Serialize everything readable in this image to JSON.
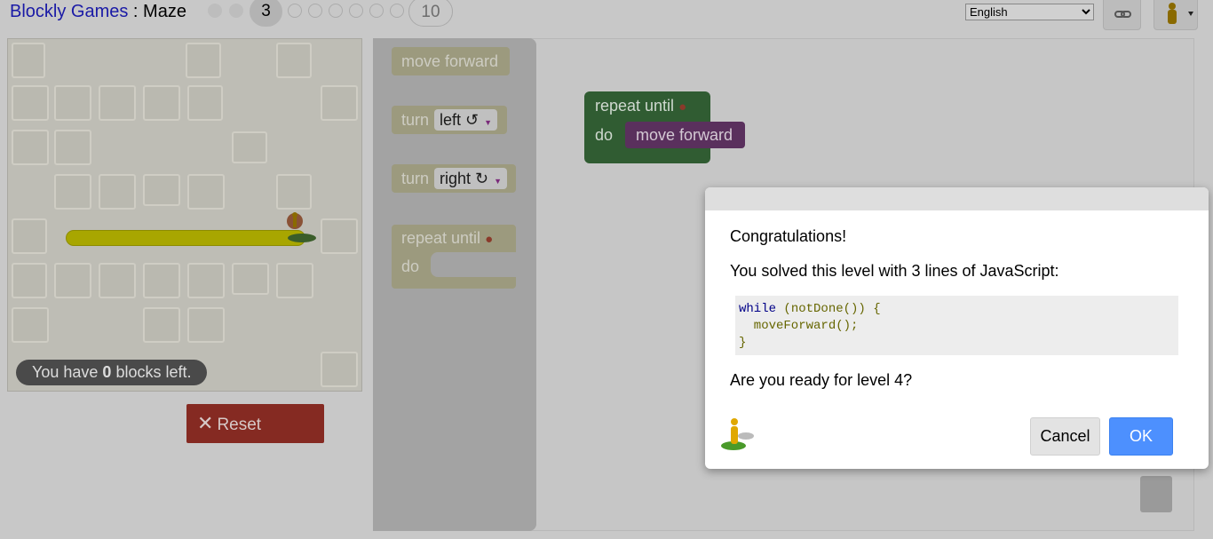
{
  "header": {
    "app_link": "Blockly Games",
    "separator": " : ",
    "game_name": "Maze",
    "current_level": "3",
    "last_level": "10",
    "language": "English"
  },
  "maze": {
    "blocks_left_prefix": "You have ",
    "blocks_left_count": "0",
    "blocks_left_suffix": " blocks left.",
    "reset_label": "Reset"
  },
  "toolbox": {
    "move_forward": "move forward",
    "turn": "turn",
    "left": "left ↺",
    "right": "right ↻",
    "repeat_until": "repeat until",
    "do": "do"
  },
  "workspace": {
    "repeat_until": "repeat until",
    "do": "do",
    "move_forward": "move forward"
  },
  "dialog": {
    "congrats": "Congratulations!",
    "solved": "You solved this level with 3 lines of JavaScript:",
    "code_kw": "while",
    "code_l1": " (notDone()) {",
    "code_l2": "  moveForward();",
    "code_l3": "}",
    "ready": "Are you ready for level 4?",
    "cancel": "Cancel",
    "ok": "OK"
  },
  "colors": {
    "accent": "#4d90fe",
    "reset": "#852a22",
    "loop_block": "#305c32",
    "move_block": "#5a305d"
  }
}
